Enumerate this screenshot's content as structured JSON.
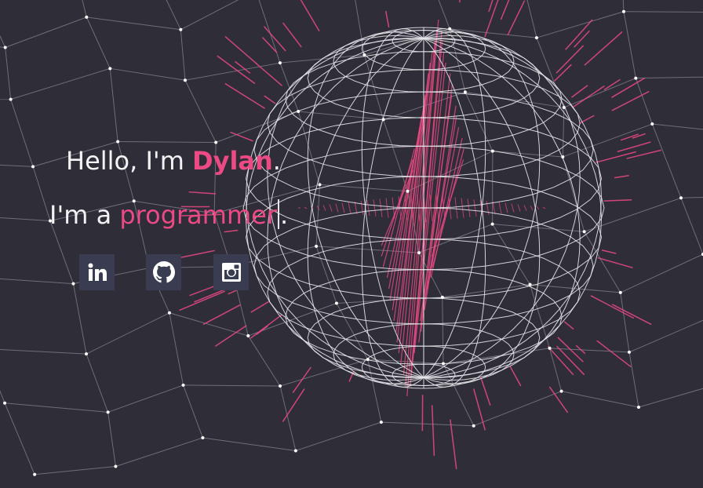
{
  "hero": {
    "greeting_prefix": "Hello, I'm ",
    "name": "Dylan",
    "greeting_suffix": ".",
    "role_prefix": "I'm a ",
    "role": "programmer",
    "role_suffix": "."
  },
  "socials": [
    {
      "icon": "linkedin-icon"
    },
    {
      "icon": "github-icon"
    },
    {
      "icon": "instagram-icon"
    }
  ],
  "colors": {
    "background": "#2e2d38",
    "accent": "#ec4a84",
    "text": "#f3f3f5",
    "social_tile": "#3a3d51",
    "wireframe": "#e6e6ea",
    "grid": "#8a8a94"
  }
}
